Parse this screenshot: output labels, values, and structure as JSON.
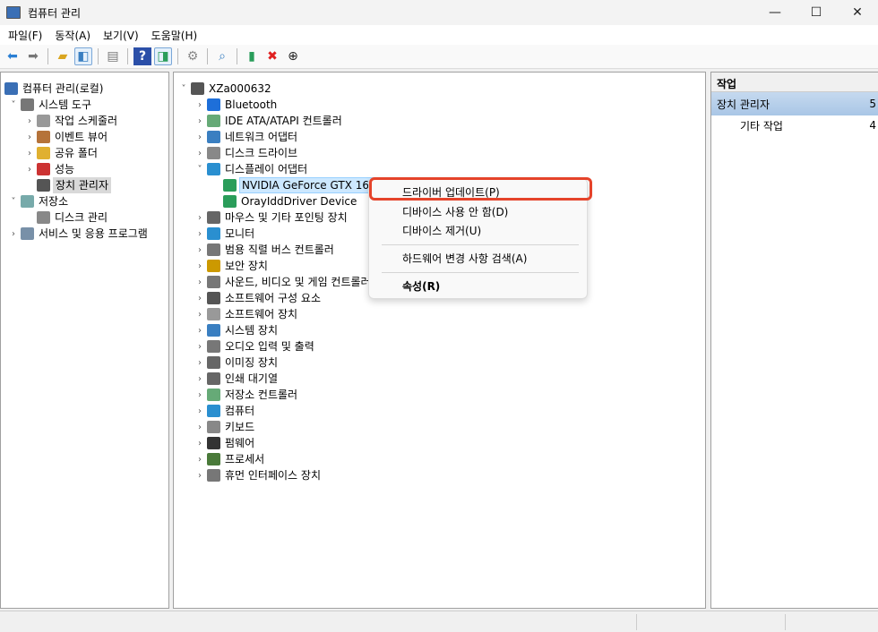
{
  "window": {
    "title": "컴퓨터 관리",
    "min": "—",
    "max": "☐",
    "close": "✕"
  },
  "menu": [
    "파일(F)",
    "동작(A)",
    "보기(V)",
    "도움말(H)"
  ],
  "left_tree": [
    {
      "label": "컴퓨터 관리(로컬)",
      "level": 0,
      "arrow": "",
      "color": "#3a6fb5"
    },
    {
      "label": "시스템 도구",
      "level": 1,
      "arrow": "˅",
      "color": "#777"
    },
    {
      "label": "작업 스케줄러",
      "level": 2,
      "arrow": "›",
      "color": "#999"
    },
    {
      "label": "이벤트 뷰어",
      "level": 2,
      "arrow": "›",
      "color": "#b5733a"
    },
    {
      "label": "공유 폴더",
      "level": 2,
      "arrow": "›",
      "color": "#e0b030"
    },
    {
      "label": "성능",
      "level": 2,
      "arrow": "›",
      "color": "#c33"
    },
    {
      "label": "장치 관리자",
      "level": 2,
      "arrow": "",
      "color": "#555",
      "state": "sel"
    },
    {
      "label": "저장소",
      "level": 1,
      "arrow": "˅",
      "color": "#7aa"
    },
    {
      "label": "디스크 관리",
      "level": 2,
      "arrow": "",
      "color": "#888"
    },
    {
      "label": "서비스 및 응용 프로그램",
      "level": 1,
      "arrow": "›",
      "color": "#7890a8"
    }
  ],
  "device_tree": [
    {
      "label": "XZa000632",
      "level": 0,
      "arrow": "˅",
      "color": "#555"
    },
    {
      "label": "Bluetooth",
      "level": 1,
      "arrow": "›",
      "color": "#1e6fd9"
    },
    {
      "label": "IDE ATA/ATAPI 컨트롤러",
      "level": 1,
      "arrow": "›",
      "color": "#6a7"
    },
    {
      "label": "네트워크 어댑터",
      "level": 1,
      "arrow": "›",
      "color": "#3a7fc1"
    },
    {
      "label": "디스크 드라이브",
      "level": 1,
      "arrow": "›",
      "color": "#888"
    },
    {
      "label": "디스플레이 어댑터",
      "level": 1,
      "arrow": "˅",
      "color": "#2a8fd0"
    },
    {
      "label": "NVIDIA GeForce GTX 1650",
      "level": 2,
      "arrow": "",
      "color": "#2a9d5a",
      "state": "focus"
    },
    {
      "label": "OrayIddDriver Device",
      "level": 2,
      "arrow": "",
      "color": "#2a9d5a"
    },
    {
      "label": "마우스 및 기타 포인팅 장치",
      "level": 1,
      "arrow": "›",
      "color": "#666"
    },
    {
      "label": "모니터",
      "level": 1,
      "arrow": "›",
      "color": "#2a8fd0"
    },
    {
      "label": "범용 직렬 버스 컨트롤러",
      "level": 1,
      "arrow": "›",
      "color": "#777"
    },
    {
      "label": "보안 장치",
      "level": 1,
      "arrow": "›",
      "color": "#c90"
    },
    {
      "label": "사운드, 비디오 및 게임 컨트롤러",
      "level": 1,
      "arrow": "›",
      "color": "#777"
    },
    {
      "label": "소프트웨어 구성 요소",
      "level": 1,
      "arrow": "›",
      "color": "#555"
    },
    {
      "label": "소프트웨어 장치",
      "level": 1,
      "arrow": "›",
      "color": "#999"
    },
    {
      "label": "시스템 장치",
      "level": 1,
      "arrow": "›",
      "color": "#3a7fc1"
    },
    {
      "label": "오디오 입력 및 출력",
      "level": 1,
      "arrow": "›",
      "color": "#777"
    },
    {
      "label": "이미징 장치",
      "level": 1,
      "arrow": "›",
      "color": "#666"
    },
    {
      "label": "인쇄 대기열",
      "level": 1,
      "arrow": "›",
      "color": "#666"
    },
    {
      "label": "저장소 컨트롤러",
      "level": 1,
      "arrow": "›",
      "color": "#6a7"
    },
    {
      "label": "컴퓨터",
      "level": 1,
      "arrow": "›",
      "color": "#2a8fd0"
    },
    {
      "label": "키보드",
      "level": 1,
      "arrow": "›",
      "color": "#888"
    },
    {
      "label": "펌웨어",
      "level": 1,
      "arrow": "›",
      "color": "#333"
    },
    {
      "label": "프로세서",
      "level": 1,
      "arrow": "›",
      "color": "#4a7a3a"
    },
    {
      "label": "휴먼 인터페이스 장치",
      "level": 1,
      "arrow": "›",
      "color": "#777"
    }
  ],
  "actions": {
    "header": "작업",
    "group": "장치 관리자",
    "group_arrow": "5",
    "item": "기타 작업",
    "item_arrow": "4"
  },
  "context_menu": {
    "items": [
      "드라이버 업데이트(P)",
      "디바이스 사용 안 함(D)",
      "디바이스 제거(U)",
      "하드웨어 변경 사항 검색(A)",
      "속성(R)"
    ]
  }
}
